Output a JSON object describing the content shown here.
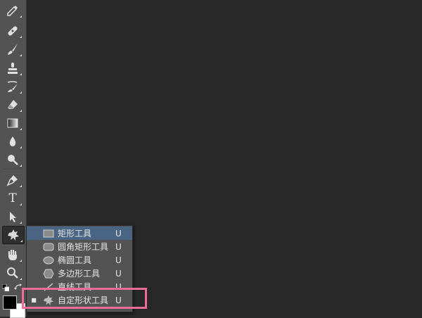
{
  "toolbar": {
    "tools": [
      {
        "name": "eyedropper-icon"
      },
      {
        "name": "healing-brush-icon"
      },
      {
        "name": "brush-icon"
      },
      {
        "name": "clone-stamp-icon"
      },
      {
        "name": "history-brush-icon"
      },
      {
        "name": "eraser-icon"
      },
      {
        "name": "gradient-icon"
      },
      {
        "name": "blur-icon"
      },
      {
        "name": "dodge-icon"
      },
      {
        "name": "pen-icon"
      },
      {
        "name": "type-icon"
      },
      {
        "name": "path-selection-icon"
      },
      {
        "name": "custom-shape-icon"
      },
      {
        "name": "hand-icon"
      },
      {
        "name": "zoom-icon"
      }
    ],
    "type_glyph": "T",
    "foreground_color": "#000000",
    "background_color": "#ffffff"
  },
  "flyout": {
    "items": [
      {
        "label": "矩形工具",
        "shortcut": "U",
        "icon": "rectangle-icon",
        "selected": false
      },
      {
        "label": "圆角矩形工具",
        "shortcut": "U",
        "icon": "rounded-rectangle-icon",
        "selected": false
      },
      {
        "label": "椭圆工具",
        "shortcut": "U",
        "icon": "ellipse-icon",
        "selected": false
      },
      {
        "label": "多边形工具",
        "shortcut": "U",
        "icon": "polygon-icon",
        "selected": false
      },
      {
        "label": "直线工具",
        "shortcut": "U",
        "icon": "line-icon",
        "selected": false
      },
      {
        "label": "自定形状工具",
        "shortcut": "U",
        "icon": "custom-shape-icon",
        "selected": true
      }
    ],
    "selected_marker": "■"
  },
  "colors": {
    "canvas": "#282828",
    "panel": "#535353",
    "hover": "#4a6484",
    "highlight_border": "#ef6b9a"
  }
}
